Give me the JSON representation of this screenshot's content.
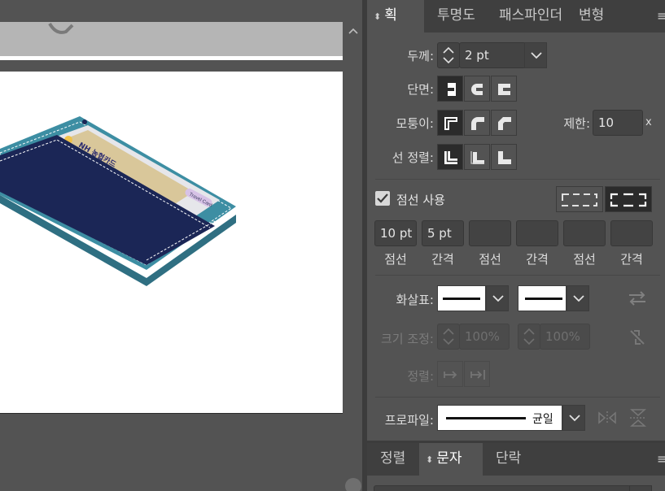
{
  "stroke_panel": {
    "tabs": [
      {
        "label": "획",
        "active": true
      },
      {
        "label": "투명도",
        "active": false
      },
      {
        "label": "패스파인더",
        "active": false
      },
      {
        "label": "변형",
        "active": false
      }
    ],
    "weight": {
      "label": "두께:",
      "value": "2 pt"
    },
    "cap": {
      "label": "단면:"
    },
    "corner": {
      "label": "모퉁이:",
      "limit_label": "제한:",
      "limit_value": "10",
      "limit_unit": "x"
    },
    "align": {
      "label": "선 정렬:"
    },
    "dashed": {
      "checkbox_label": "점선 사용",
      "checked": true
    },
    "dash_values": [
      "10 pt",
      "5 pt",
      "",
      "",
      "",
      ""
    ],
    "dash_labels": [
      "점선",
      "간격",
      "점선",
      "간격",
      "점선",
      "간격"
    ],
    "arrowheads": {
      "label": "화살표:"
    },
    "scale": {
      "label": "크기 조정:",
      "start": "100%",
      "end": "100%"
    },
    "arrow_align": {
      "label": "정렬:"
    },
    "profile": {
      "label": "프로파일:",
      "value": "균일"
    }
  },
  "bottom_panel": {
    "tabs": [
      {
        "label": "정렬",
        "active": false
      },
      {
        "label": "문자",
        "active": true
      },
      {
        "label": "단락",
        "active": false
      }
    ]
  },
  "artwork": {
    "card_text": "NH 농협카드",
    "card_badge": "Travel Card"
  },
  "colors": {
    "panel_bg": "#535353",
    "tab_bar": "#3f3f3f",
    "selected_button": "#2b2b2b",
    "card_navy": "#1b2656",
    "card_teal": "#3d8ea3"
  }
}
